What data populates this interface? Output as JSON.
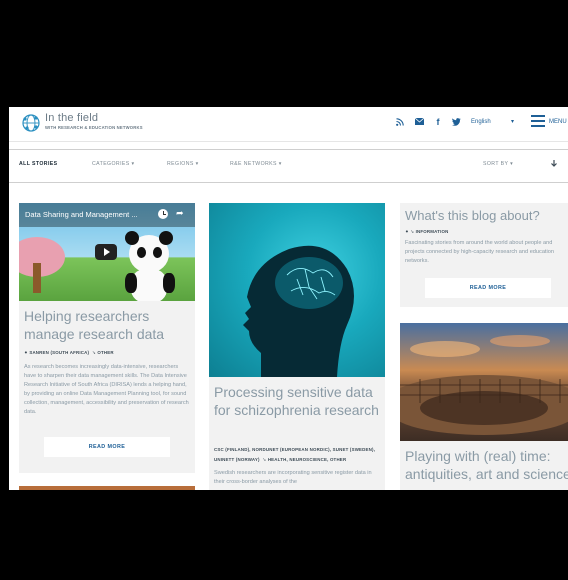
{
  "header": {
    "title": "In the field",
    "subtitle": "WITH RESEARCH & EDUCATION NETWORKS",
    "language": "English",
    "menu_label": "MENU",
    "icons": [
      "rss-icon",
      "mail-icon",
      "facebook-icon",
      "twitter-icon"
    ],
    "accent_color": "#1e5f96"
  },
  "nav": {
    "all_stories": "ALL STORIES",
    "categories": "CATEGORIES ▾",
    "regions": "REGIONS ▾",
    "rse_networks": "R&E NETWORKS ▾",
    "sort_by": "SORT BY ▾"
  },
  "cards": {
    "video": {
      "video_title": "Data Sharing and Management ...",
      "title": "Helping researchers manage research data",
      "meta_author": "SANREN (SOUTH AFRICA)",
      "meta_tag": "OTHER",
      "excerpt": "As research becomes increasingly data-intensive, researchers have to sharpen their data management skills. The Data Intensive Research Initiative of South Africa (DIRISA) lends a helping hand, by providing an online Data Management Planning tool, for sound collection, management, accessibility and preservation of research data.",
      "read_more": "READ MORE"
    },
    "brain": {
      "title": "Processing sensitive data for schizophrenia research",
      "meta_line1": "CSC (FINLAND), NORDUNET (EUROPEAN NORDIC), SUNET (SWEDEN),",
      "meta_line2": "UNINETT (NORWAY)",
      "meta_tags": "HEALTH, NEUROSCIENCE, OTHER",
      "excerpt": "Swedish researchers are incorporating sensitive register data in their cross-border analyses of the"
    },
    "about": {
      "title": "What's this blog about?",
      "meta_tag": "INFORMATION",
      "excerpt": "Fascinating stories from around the world about people and projects connected by high-capacity research and education networks.",
      "read_more": "READ MORE"
    },
    "colosseum": {
      "title": "Playing with (real) time: antiquities, art and science"
    }
  }
}
